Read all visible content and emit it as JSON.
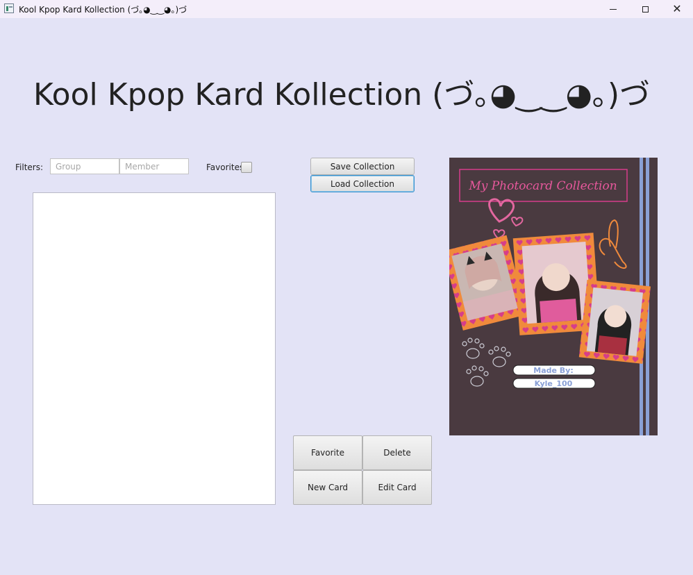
{
  "window": {
    "title": "Kool Kpop Kard Kollection (づ｡◕‿‿◕｡)づ"
  },
  "heading": "Kool Kpop Kard Kollection (づ｡◕‿‿◕｡)づ",
  "filters": {
    "label": "Filters:",
    "group_placeholder": "Group",
    "member_placeholder": "Member",
    "favorites_label": "Favorites",
    "favorites_checked": false
  },
  "collection_buttons": {
    "save": "Save Collection",
    "load": "Load Collection"
  },
  "card_buttons": {
    "favorite": "Favorite",
    "delete": "Delete",
    "new_card": "New Card",
    "edit_card": "Edit Card"
  },
  "card_list": {
    "items": []
  },
  "cover_image": {
    "title": "My Photocard Collection",
    "made_by_label": "Made By:",
    "author": "Kyle_100",
    "colors": {
      "background": "#4a3a40",
      "accent_pink": "#d63d8a",
      "frame_orange": "#f08a3c",
      "stripe_blue": "#8aa0d6"
    }
  }
}
